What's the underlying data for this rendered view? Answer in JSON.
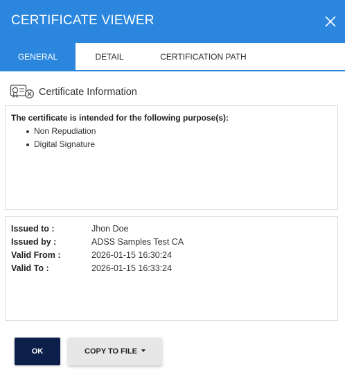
{
  "header": {
    "title": "CERTIFICATE VIEWER",
    "close_icon": "close-icon"
  },
  "tabs": [
    {
      "label": "GENERAL",
      "active": true
    },
    {
      "label": "DETAIL",
      "active": false
    },
    {
      "label": "CERTIFICATION PATH",
      "active": false
    }
  ],
  "section": {
    "icon": "certificate-icon",
    "title": "Certificate Information"
  },
  "purposes": {
    "heading": "The certificate is intended for the following purpose(s):",
    "items": [
      "Non Repudiation",
      "Digital Signature"
    ]
  },
  "details": {
    "issued_to": {
      "label": "Issued to :",
      "value": "Jhon Doe"
    },
    "issued_by": {
      "label": "Issued by :",
      "value": "ADSS Samples Test CA"
    },
    "valid_from": {
      "label": "Valid From :",
      "value": "2026-01-15 16:30:24"
    },
    "valid_to": {
      "label": "Valid To :",
      "value": "2026-01-15 16:33:24"
    }
  },
  "actions": {
    "ok_label": "OK",
    "copy_label": "COPY TO FILE",
    "copy_icon": "caret-down-icon"
  },
  "colors": {
    "header": "#2b86de",
    "active_tab": "#2b86de",
    "ok_button": "#0c1f4a",
    "secondary_button": "#e7e7e7"
  }
}
